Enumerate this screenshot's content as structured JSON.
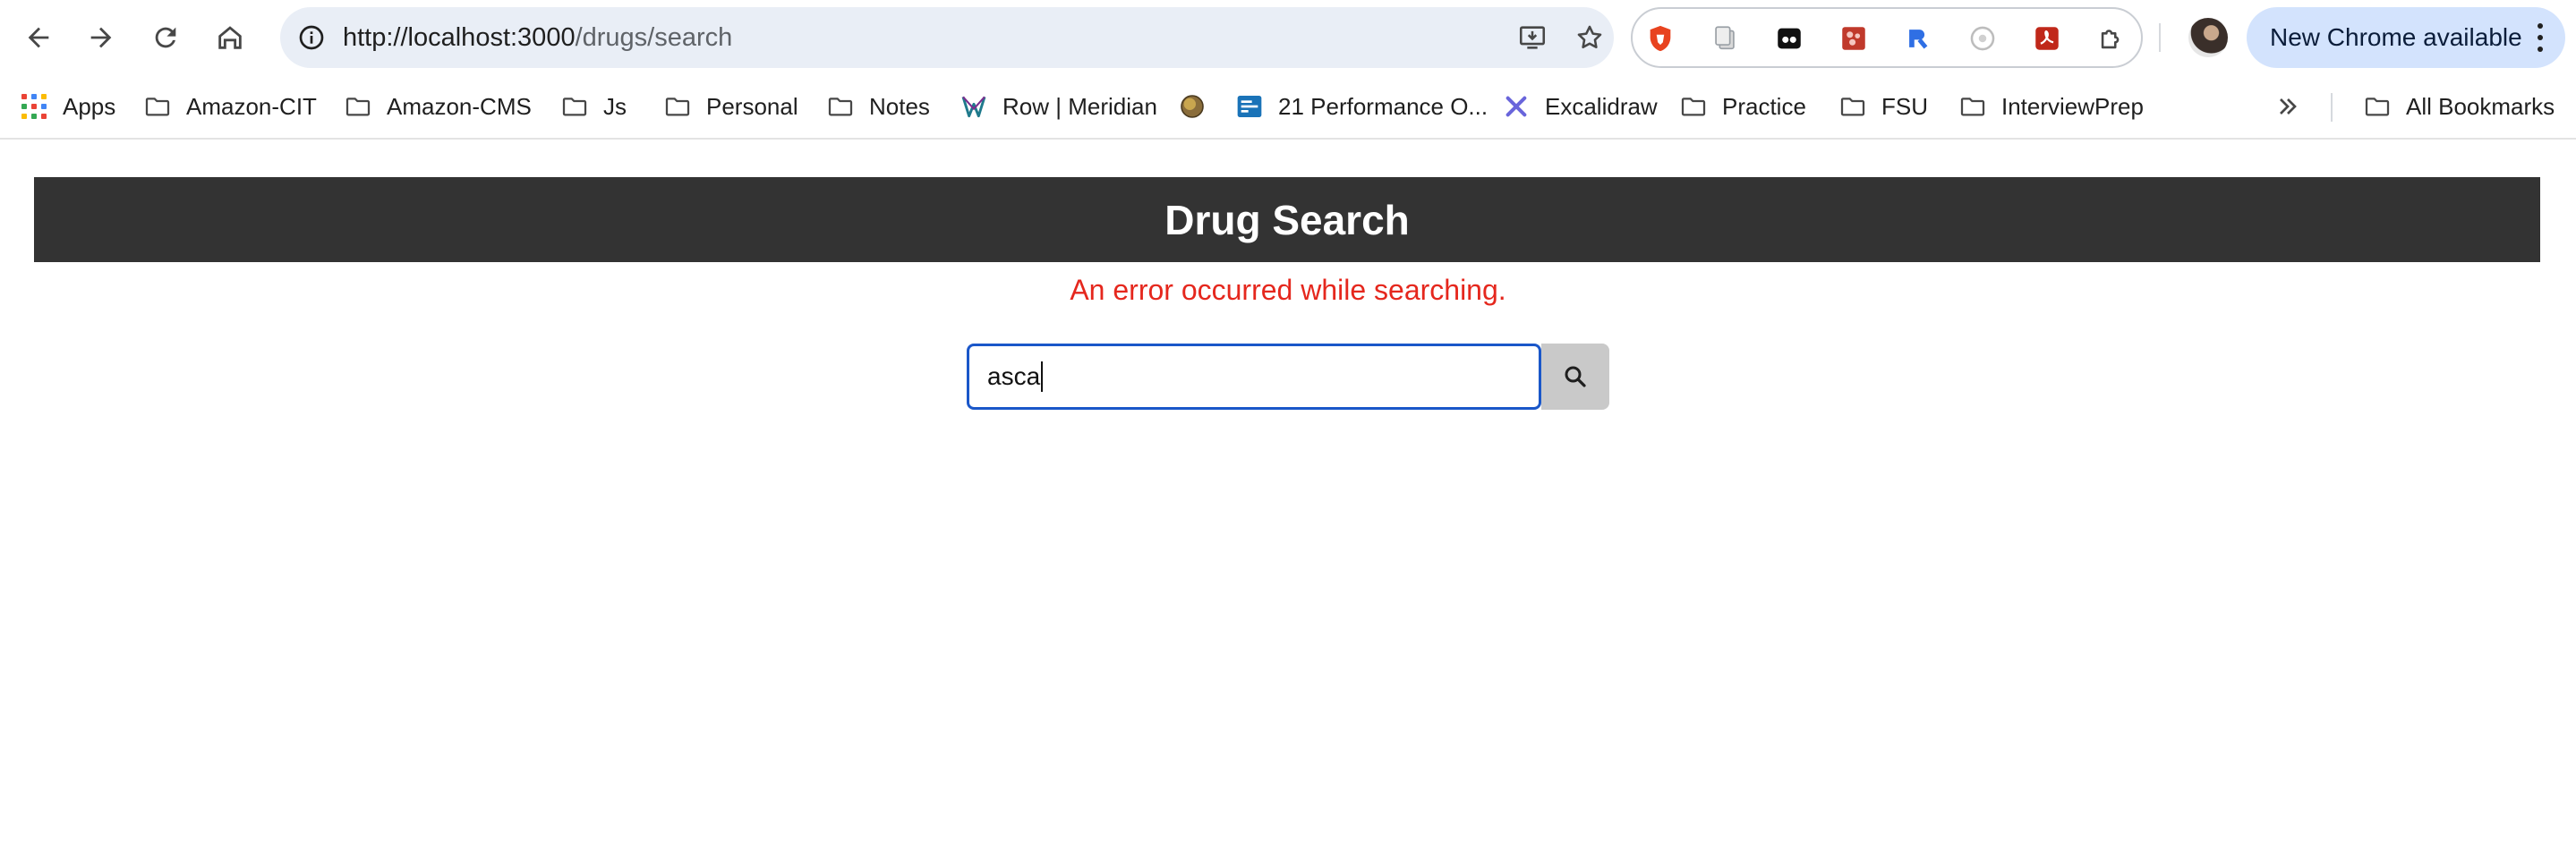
{
  "browser": {
    "url_host": "http://localhost:3000",
    "url_path": "/drugs/search",
    "new_chrome_label": "New Chrome available"
  },
  "bookmarks": {
    "items": [
      {
        "label": "Apps",
        "icon": "apps-grid-icon"
      },
      {
        "label": "Amazon-CIT",
        "icon": "folder-icon"
      },
      {
        "label": "Amazon-CMS",
        "icon": "folder-icon"
      },
      {
        "label": "Js",
        "icon": "folder-icon"
      },
      {
        "label": "Personal",
        "icon": "folder-icon"
      },
      {
        "label": "Notes",
        "icon": "folder-icon"
      },
      {
        "label": "Row | Meridian",
        "icon": "meridian-logo-icon"
      },
      {
        "label": "",
        "icon": "globe-favicon-icon"
      },
      {
        "label": "21 Performance O...",
        "icon": "site-favicon-icon"
      },
      {
        "label": "Excalidraw",
        "icon": "excalidraw-logo-icon"
      },
      {
        "label": "Practice",
        "icon": "folder-icon"
      },
      {
        "label": "FSU",
        "icon": "folder-icon"
      },
      {
        "label": "InterviewPrep",
        "icon": "folder-icon"
      }
    ],
    "all_bookmarks_label": "All Bookmarks"
  },
  "page": {
    "title": "Drug Search",
    "error": "An error occurred while searching.",
    "search_value": "asca",
    "search_icon": "magnifier-icon"
  },
  "colors": {
    "header_bg": "#333333",
    "error_text": "#e5271d",
    "input_focus_border": "#1a57c9",
    "search_button_bg": "#c9c9c9"
  }
}
